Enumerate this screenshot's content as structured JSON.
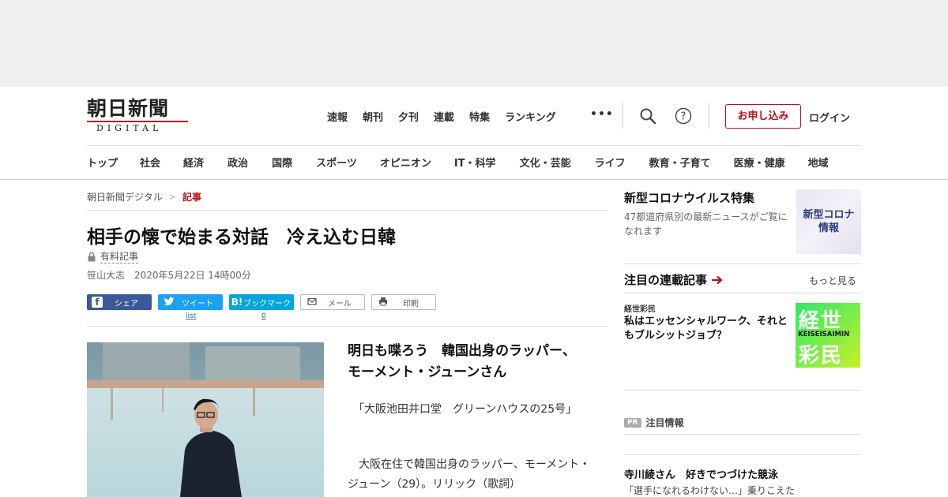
{
  "header": {
    "logo_kanji": "朝日新聞",
    "logo_sub": "DIGITAL",
    "topnav": [
      "速報",
      "朝刊",
      "夕刊",
      "連載",
      "特集",
      "ランキング"
    ],
    "more": "•••",
    "signup": "お申し込み",
    "login": "ログイン"
  },
  "catnav": [
    "トップ",
    "社会",
    "経済",
    "政治",
    "国際",
    "スポーツ",
    "オピニオン",
    "IT・科学",
    "文化・芸能",
    "ライフ",
    "教育・子育て",
    "医療・健康",
    "地域"
  ],
  "breadcrumb": {
    "home": "朝日新聞デジタル",
    "sep": ">",
    "current": "記事"
  },
  "article": {
    "title": "相手の懐で始まる対話　冷え込む日韓",
    "paid_label": "有料記事",
    "author": "笹山大志",
    "date": "2020年5月22日 14時00分",
    "share": {
      "facebook": "シェア",
      "twitter": "ツイート",
      "hatena": "ブックマーク",
      "mail": "メール",
      "print": "印刷",
      "twitter_count": "list",
      "hatena_count": "0"
    },
    "lead_title": "明日も喋ろう　韓国出身のラッパー、モーメント・ジューンさん",
    "para1": "　「大阪池田井口堂　グリーンハウスの25号」",
    "para2": "　大阪在住で韓国出身のラッパー、モーメント・ジューン（29）。リリック（歌詞）"
  },
  "sidebar": {
    "covid_title": "新型コロナウイルス特集",
    "covid_desc": "47都道府県別の最新ニュースがご覧になれます",
    "covid_thumb_1": "新型コロナ",
    "covid_thumb_2": "情報",
    "serial_title": "注目の連載記事",
    "more": "もっと見る",
    "series_name": "経世彩民",
    "item_title": "私はエッセンシャルワーク、それともブルシットジョブ？",
    "keisei_1": "経世",
    "keisei_2": "KEISEISAIMIN",
    "keisei_3": "彩民",
    "pr_badge": "PR",
    "pr_label": "注目情報",
    "terakawa_title": "寺川綾さん　好きでつづけた競泳",
    "terakawa_sub": "「選手になれるわけない…」乗りこえた"
  },
  "colors": {
    "brand_red": "#b5121b",
    "facebook": "#3b5998",
    "twitter": "#1da1f2",
    "hatena": "#00a4de"
  }
}
